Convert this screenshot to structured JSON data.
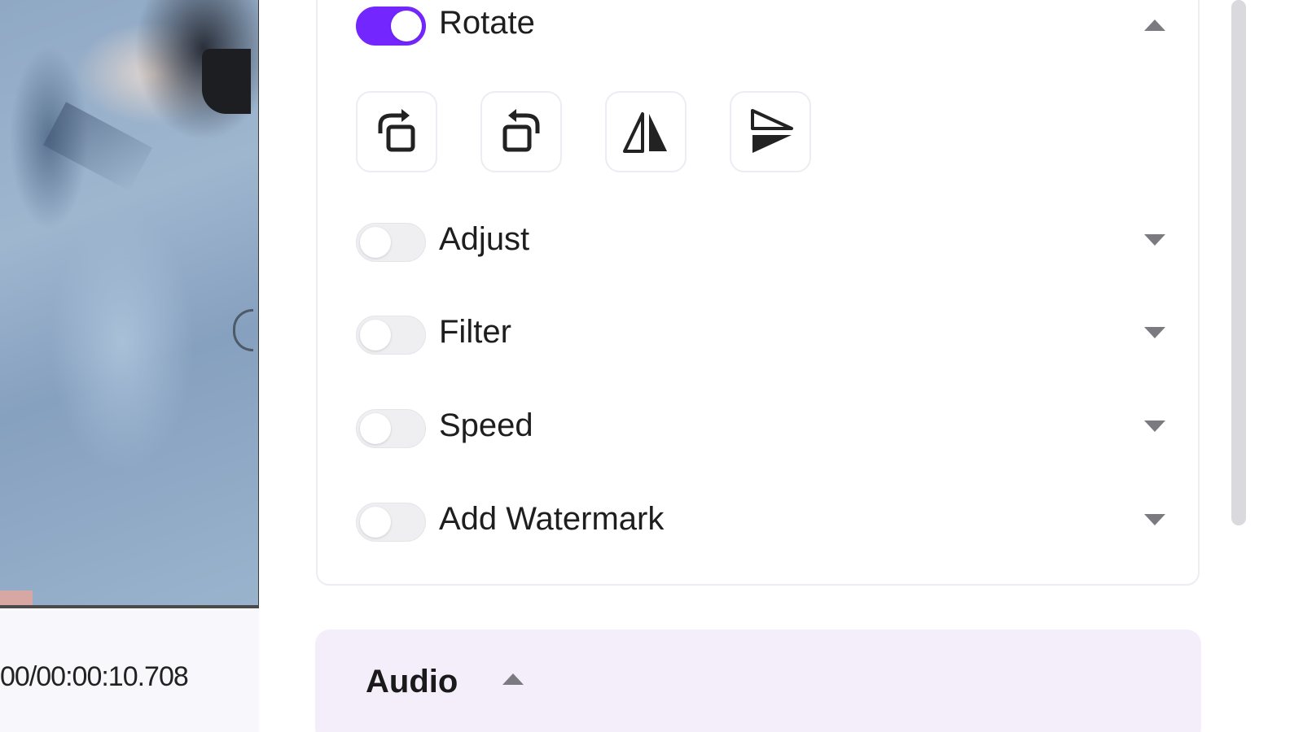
{
  "player": {
    "timecode": "00/00:00:10.708"
  },
  "settings": {
    "rotate": {
      "label": "Rotate",
      "enabled": true
    },
    "rotate_tools": [
      {
        "name": "rotate-clockwise-icon"
      },
      {
        "name": "rotate-counterclockwise-icon"
      },
      {
        "name": "flip-horizontal-icon"
      },
      {
        "name": "flip-vertical-icon"
      }
    ],
    "adjust": {
      "label": "Adjust",
      "enabled": false
    },
    "filter": {
      "label": "Filter",
      "enabled": false
    },
    "speed": {
      "label": "Speed",
      "enabled": false
    },
    "watermark": {
      "label": "Add Watermark",
      "enabled": false
    }
  },
  "audio": {
    "title": "Audio"
  },
  "colors": {
    "accent": "#7426ff",
    "audio_bg": "#f3eef9"
  }
}
